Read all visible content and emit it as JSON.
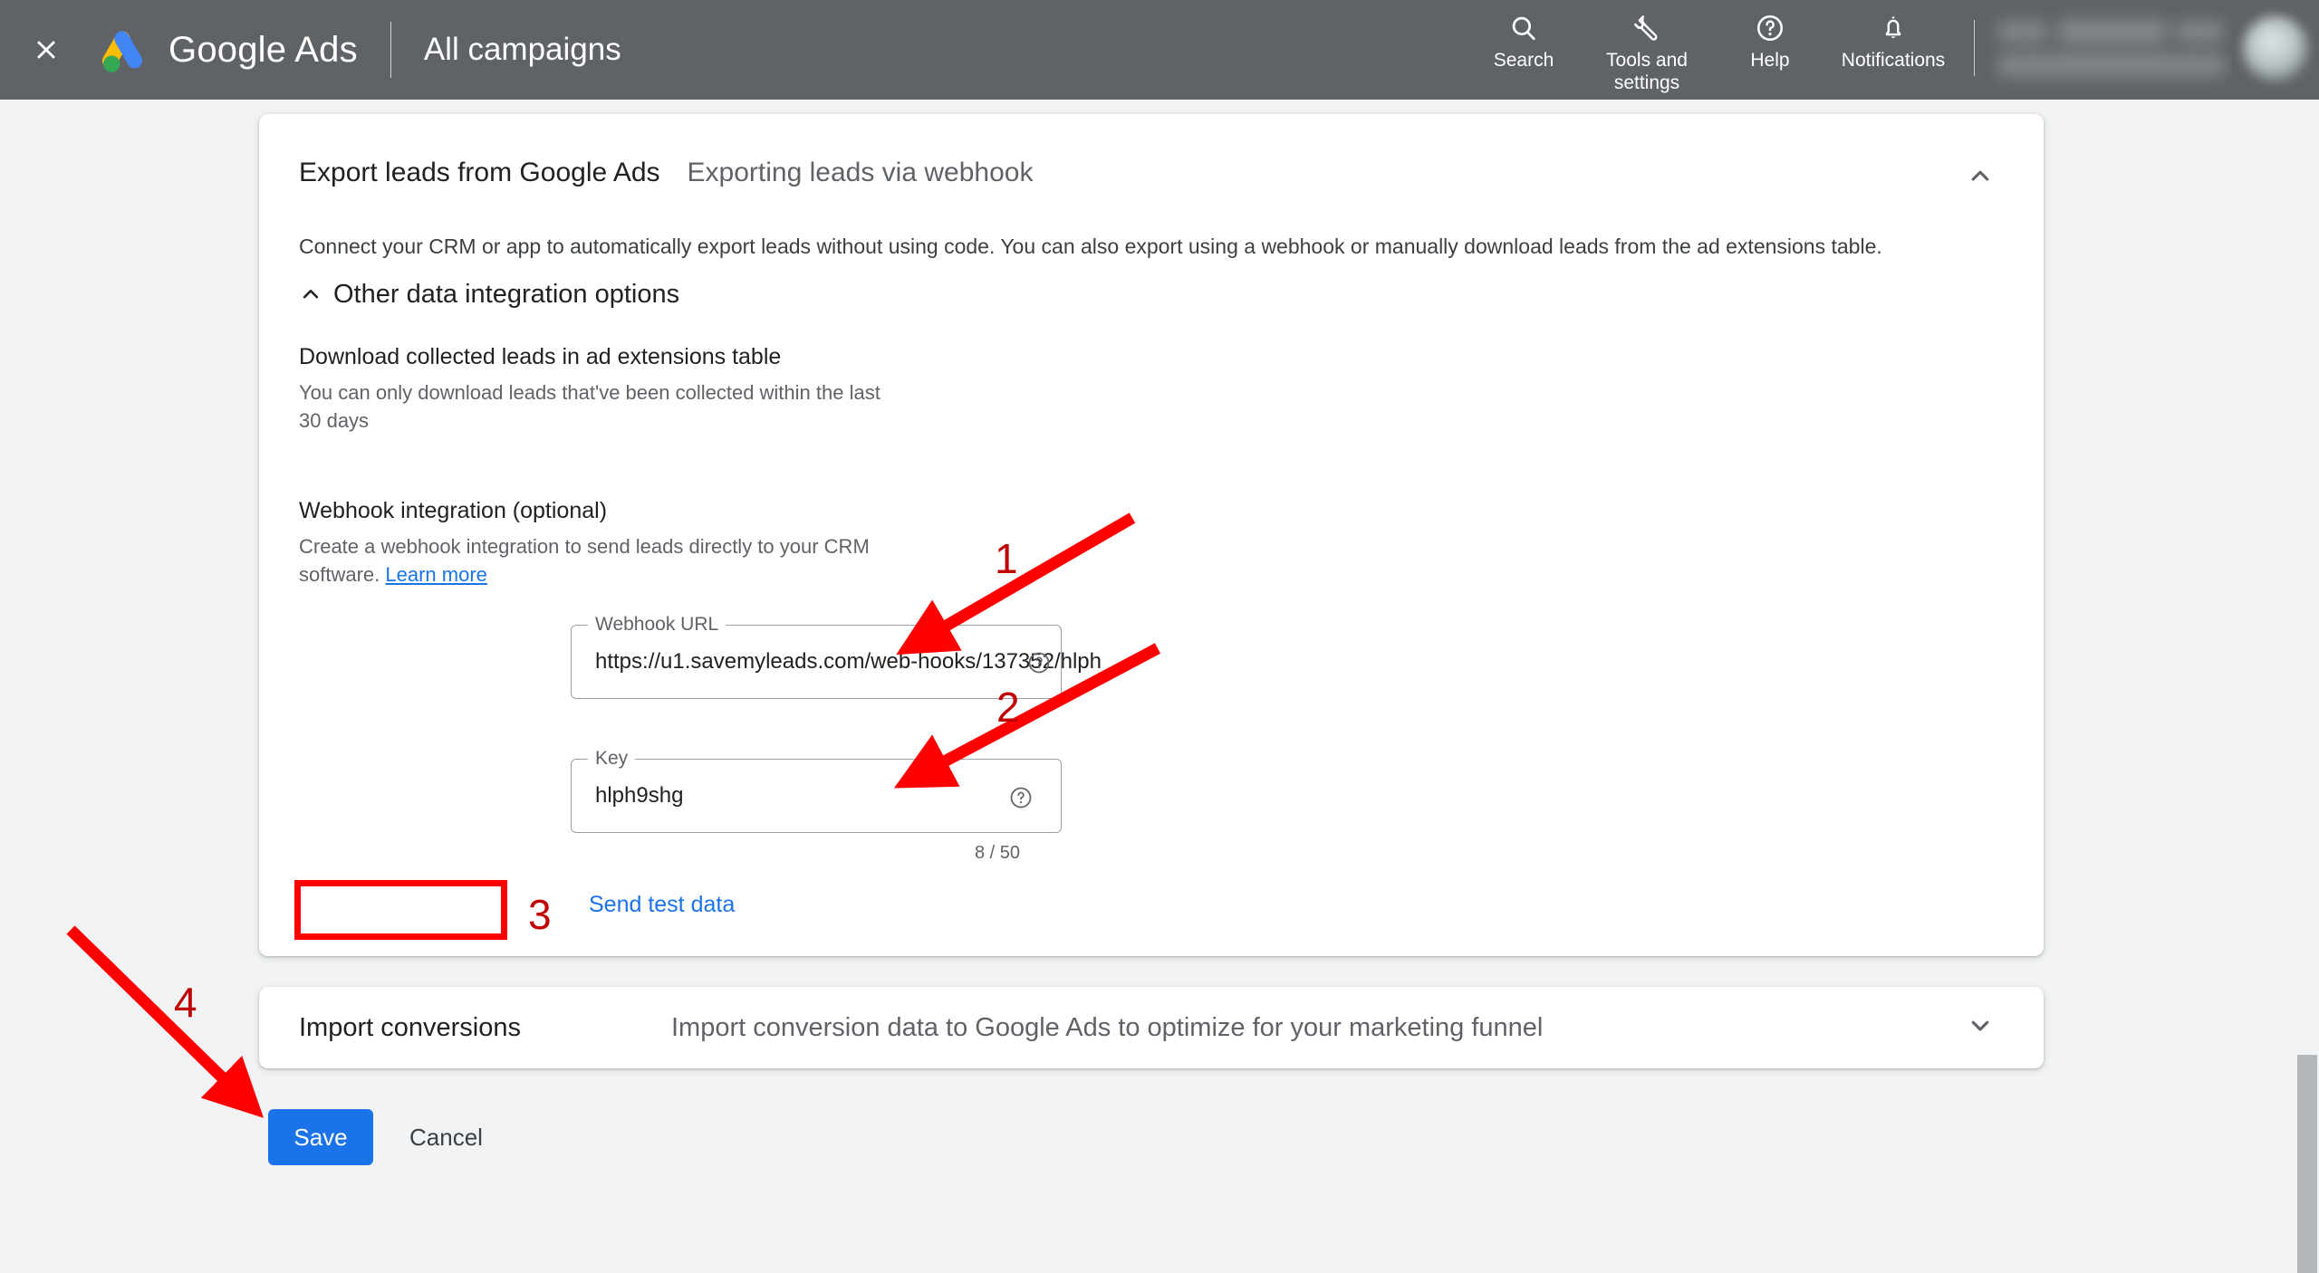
{
  "appbar": {
    "close_icon": "close-icon",
    "logo_icon": "google-ads-logo",
    "brand": "Google Ads",
    "page_title": "All campaigns",
    "items": [
      {
        "icon": "search-icon",
        "label": "Search"
      },
      {
        "icon": "wrench-icon",
        "label": "Tools and\nsettings"
      },
      {
        "icon": "help-circle-icon",
        "label": "Help"
      },
      {
        "icon": "bell-icon",
        "label": "Notifications"
      }
    ],
    "account_blurred": true,
    "avatar": "user-avatar"
  },
  "export_card": {
    "title": "Export leads from Google Ads",
    "subtitle": "Exporting leads via webhook",
    "collapse_icon": "chevron-up-icon",
    "description": "Connect your CRM or app to automatically export leads without using code. You can also export using a webhook or manually download leads from the ad extensions table.",
    "section_toggle": {
      "icon": "chevron-up-icon",
      "label": "Other data integration options"
    },
    "download_block": {
      "title": "Download collected leads in ad extensions table",
      "description": "You can only download leads that've been collected within the last 30 days"
    },
    "webhook_block": {
      "title": "Webhook integration (optional)",
      "description": "Create a webhook integration to send leads directly to your CRM software.",
      "link_label": "Learn more"
    },
    "fields": {
      "webhook_url": {
        "legend": "Webhook URL",
        "value": "https://u1.savemyleads.com/web-hooks/137352/hlph",
        "help_icon": "help-circle-icon"
      },
      "key": {
        "legend": "Key",
        "value": "hlph9shg",
        "help_icon": "help-circle-icon",
        "counter": "8 / 50"
      }
    },
    "send_test_label": "Send test data"
  },
  "import_card": {
    "title": "Import conversions",
    "subtitle": "Import conversion data to Google Ads to optimize for your marketing funnel",
    "expand_icon": "chevron-down-icon"
  },
  "footer": {
    "save_label": "Save",
    "cancel_label": "Cancel"
  },
  "annotations": {
    "color": "#ff0000",
    "number_color": "#c00000",
    "markers": [
      {
        "label": "1",
        "target": "webhook-url-field"
      },
      {
        "label": "2",
        "target": "key-field"
      },
      {
        "label": "3",
        "target": "send-test-data-button"
      },
      {
        "label": "4",
        "target": "save-button"
      }
    ]
  },
  "colors": {
    "appbar_bg": "#5f6368",
    "page_bg": "#f1f3f4",
    "card_bg": "#ffffff",
    "accent_blue": "#1a73e8",
    "annotation_red": "#ff0000"
  }
}
